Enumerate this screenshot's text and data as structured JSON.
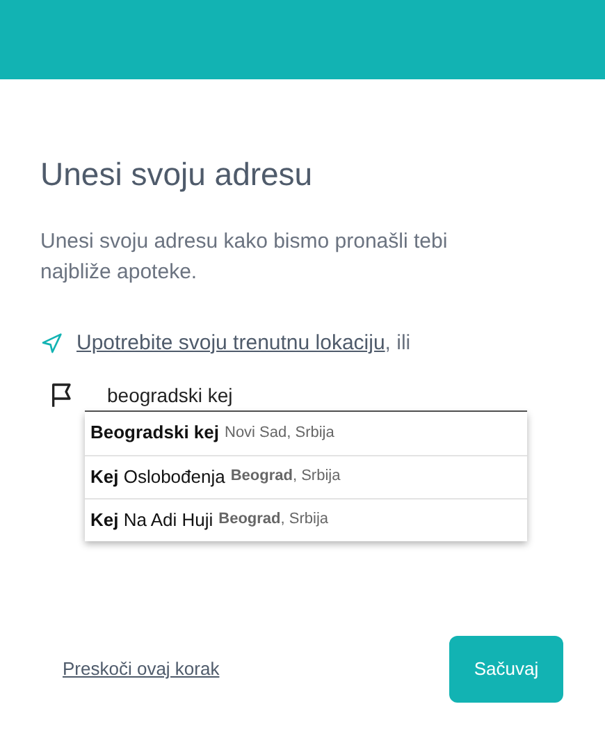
{
  "title": "Unesi svoju adresu",
  "description": "Unesi svoju adresu kako bismo pronašli tebi najbliže apoteke.",
  "location": {
    "link": "Upotrebite svoju trenutnu lokaciju",
    "suffix": ", ili"
  },
  "address_field": {
    "value": "beogradski kej"
  },
  "suggestions": [
    {
      "main": "**Beogradski kej**",
      "secondary": "Novi Sad, Srbija"
    },
    {
      "main": "**Kej** Oslobođenja",
      "secondary": "**Beograd**, Srbija"
    },
    {
      "main": "**Kej** Na Adi Huji",
      "secondary": "**Beograd**, Srbija"
    }
  ],
  "skip_link": "Preskoči ovaj korak",
  "save_button": "Sačuvaj"
}
